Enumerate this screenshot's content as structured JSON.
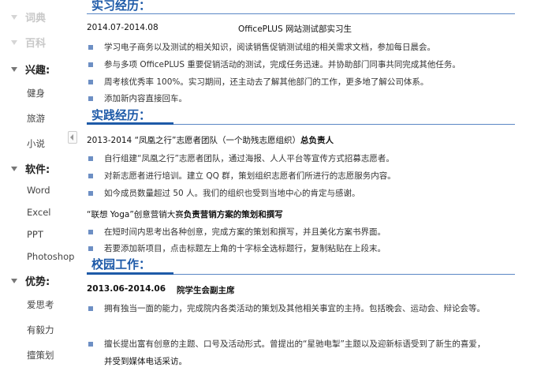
{
  "sidebar": {
    "faded_items": [
      "词典",
      "百科"
    ],
    "sections": [
      {
        "title": "兴趣:",
        "items": [
          "健身",
          "旅游",
          "小说"
        ]
      },
      {
        "title": "软件:",
        "items": [
          "Word",
          "Excel",
          "PPT",
          "Photoshop"
        ]
      },
      {
        "title": "优势:",
        "items": [
          "爱思考",
          "有毅力",
          "擅策划"
        ]
      }
    ]
  },
  "internship": {
    "title": "实习经历：",
    "date": "2014.07-2014.08",
    "org": "OfficePLUS 网站测试部实习生",
    "bullets": [
      "学习电子商务以及测试的相关知识，阅读销售促销测试组的相关需求文档，参加每日晨会。",
      "参与多项 OfficePLUS 重要促销活动的测试，完成任务迅速。并协助部门同事共同完成其他任务。",
      "周考核优秀率 100%。实习期间，还主动去了解其他部门的工作，更多地了解公司体系。",
      "添加新内容直接回车。"
    ]
  },
  "practice": {
    "title": "实践经历：",
    "entry1_head": "2013-2014 “凤凰之行”志愿者团队（一个助残志愿组织）",
    "entry1_role": "总负责人",
    "entry1_bullets": [
      "自行组建“凤凰之行”志愿者团队，通过海报、人人平台等宣传方式招募志愿者。",
      "对新志愿者进行培训。建立 QQ 群，策划组织志愿者们所进行的志愿服务内容。",
      "如今成员数量超过 50 人。我们的组织也受到当地中心的肯定与感谢。"
    ],
    "entry2_head": "“联想 Yoga”创意营销大赛",
    "entry2_role": "负责营销方案的策划和撰写",
    "entry2_bullets": [
      "在短时间内思考出各种创意，完成方案的策划和撰写，并且美化方案书界面。",
      "若要添加新项目，点击标题左上角的十字标全选标题行，复制粘贴在上段末。"
    ]
  },
  "campus": {
    "title": "校园工作：",
    "date": "2013.06-2014.06",
    "role": "院学生会副主席",
    "bullet1": "拥有独当一面的能力，完成院内各类活动的策划及其他相关事宜的主持。包括晚会、运动会、辩论会等。",
    "bullet2": "擅长提出富有创意的主题、口号及活动形式。曾提出的“星驰电掣”主题以及迎新标语受到了新生的喜爱，",
    "bullet2_cont": "并受到媒体电话采访。"
  }
}
